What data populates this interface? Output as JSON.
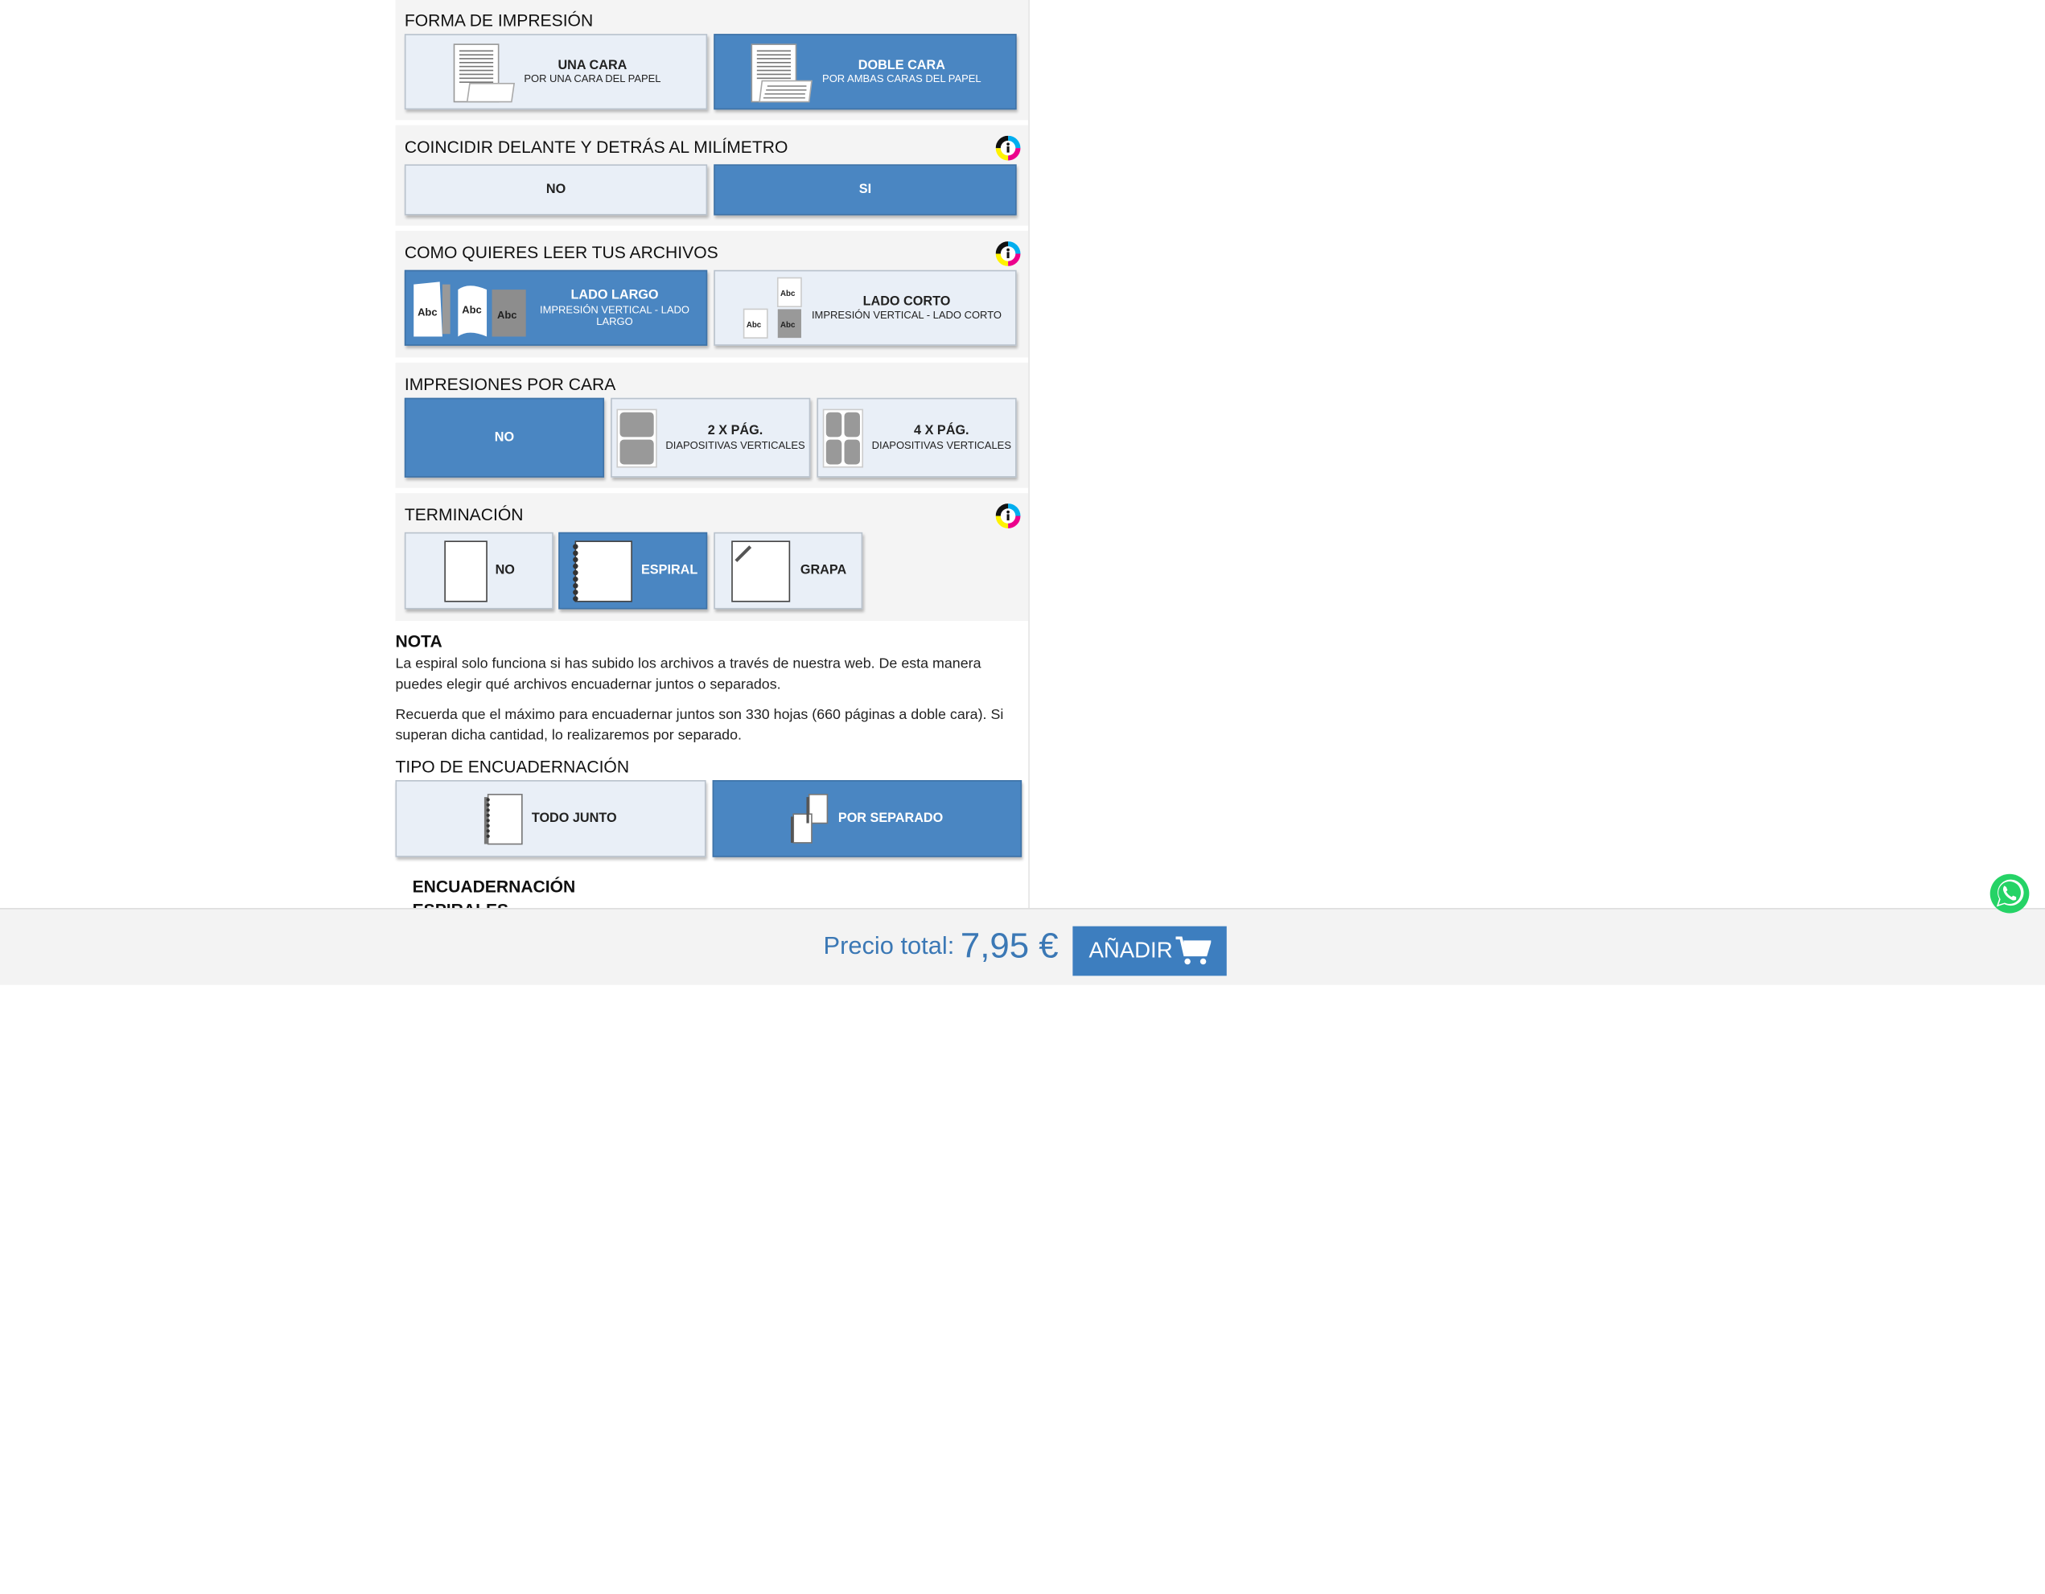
{
  "sections": {
    "print_form": {
      "title": "FORMA DE IMPRESIÓN",
      "options": [
        {
          "title": "UNA CARA",
          "subtitle": "POR UNA CARA DEL PAPEL"
        },
        {
          "title": "DOBLE CARA",
          "subtitle": "POR AMBAS CARAS DEL PAPEL"
        }
      ],
      "selected": "DOBLE CARA"
    },
    "match": {
      "title": "COINCIDIR DELANTE Y DETRÁS AL MILÍMETRO",
      "options": [
        "NO",
        "SI"
      ],
      "selected": "SI"
    },
    "read": {
      "title": "COMO QUIERES LEER TUS ARCHIVOS",
      "options": [
        {
          "title": "LADO LARGO",
          "subtitle": "IMPRESIÓN VERTICAL - LADO LARGO"
        },
        {
          "title": "LADO CORTO",
          "subtitle": "IMPRESIÓN VERTICAL - LADO CORTO"
        }
      ],
      "icon_text": "Abc",
      "selected": "LADO LARGO"
    },
    "per_side": {
      "title": "IMPRESIONES POR CARA",
      "options": [
        {
          "title": "NO",
          "subtitle": ""
        },
        {
          "title": "2 X PÁG.",
          "subtitle": "DIAPOSITIVAS VERTICALES"
        },
        {
          "title": "4 X PÁG.",
          "subtitle": "DIAPOSITIVAS VERTICALES"
        }
      ],
      "selected": "NO"
    },
    "finish": {
      "title": "TERMINACIÓN",
      "options": [
        "NO",
        "ESPIRAL",
        "GRAPA"
      ],
      "selected": "ESPIRAL"
    },
    "binding_type": {
      "title": "TIPO DE ENCUADERNACIÓN",
      "options": [
        "TODO JUNTO",
        "POR SEPARADO"
      ],
      "selected": "POR SEPARADO"
    }
  },
  "note": {
    "title": "NOTA",
    "para1": "La espiral solo funciona si has subido los archivos a través de nuestra web. De esta manera puedes elegir qué archivos encuadernar juntos o separados.",
    "para2": "Recuerda que el máximo para encuadernar juntos son 330 hojas (660 páginas a doble cara). Si superan dicha cantidad, lo realizaremos por separado."
  },
  "next_section": {
    "title": "ENCUADERNACIÓN",
    "partial": "ESPIRALES"
  },
  "footer": {
    "price_label": "Precio total:",
    "price_value": "7,95 €",
    "add_label": "AÑADIR"
  },
  "colors": {
    "selected": "#4a86c2",
    "unselected": "#e9eff7",
    "price": "#3b78b5",
    "whatsapp": "#25d366"
  }
}
